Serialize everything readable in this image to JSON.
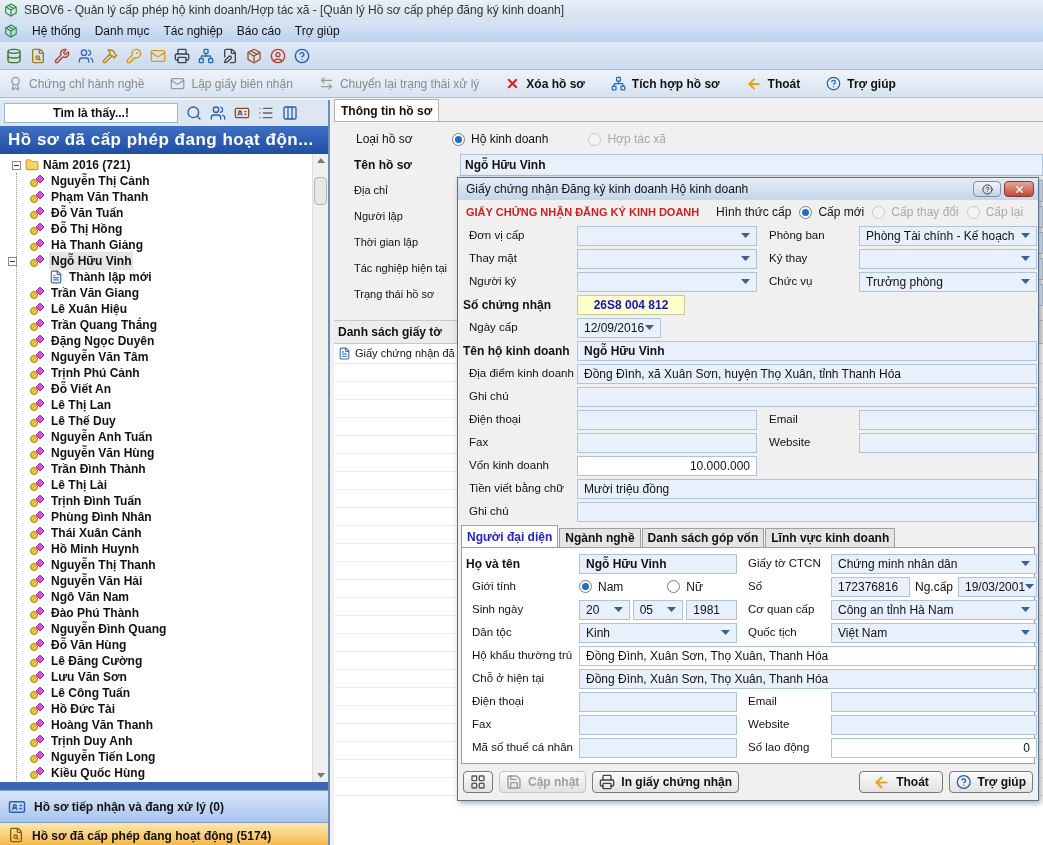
{
  "window": {
    "title": "SBOV6 - Quản lý cấp phép hộ kinh doanh/Hợp tác xã - [Quản lý Hồ sơ cấp phép đăng ký kinh doanh]"
  },
  "menu": [
    "Hệ thống",
    "Danh mục",
    "Tác nghiệp",
    "Báo cáo",
    "Trợ giúp"
  ],
  "commands": [
    {
      "label": "Chứng chỉ hành nghề",
      "kind": "certificate",
      "disabled": true
    },
    {
      "label": "Lập giấy biên nhận",
      "kind": "receipt",
      "disabled": true
    },
    {
      "label": "Chuyển lại trạng thái xử lý",
      "kind": "revert",
      "disabled": true
    },
    {
      "label": "Xóa hồ sơ",
      "kind": "delete",
      "disabled": false
    },
    {
      "label": "Tích hợp hồ sơ",
      "kind": "merge",
      "disabled": false
    },
    {
      "label": "Thoát",
      "kind": "exit",
      "disabled": false
    },
    {
      "label": "Trợ giúp",
      "kind": "help",
      "disabled": false
    }
  ],
  "sidebar": {
    "search": {
      "placeholder": "Tìm là thấy...!"
    },
    "title": "Hồ sơ đã cấp phép đang hoạt độn...",
    "tree": [
      {
        "label": "Năm 2016 (721)",
        "expanded": true,
        "children": [
          {
            "label": "Nguyễn Thị Cảnh",
            "selected": false
          },
          {
            "label": "Phạm Văn Thanh",
            "selected": false
          },
          {
            "label": "Đỗ Văn Tuấn",
            "selected": false
          },
          {
            "label": "Đỗ Thị Hồng",
            "selected": false
          },
          {
            "label": "Hà Thanh Giảng",
            "selected": false
          },
          {
            "label": "Ngỗ Hữu Vinh",
            "selected": true,
            "expanded": true,
            "children": [
              {
                "label": "Thành lập mới",
                "selected": false
              }
            ]
          },
          {
            "label": "Trần Văn Giang",
            "selected": false
          },
          {
            "label": "Lê Xuân Hiệu",
            "selected": false
          },
          {
            "label": "Trần Quang Thắng",
            "selected": false
          },
          {
            "label": "Đặng Ngọc Duyên",
            "selected": false
          },
          {
            "label": "Nguyễn Văn Tâm",
            "selected": false
          },
          {
            "label": "Trịnh Phú Cảnh",
            "selected": false
          },
          {
            "label": "Đỗ Viết An",
            "selected": false
          },
          {
            "label": "Lê Thị Lan",
            "selected": false
          },
          {
            "label": "Lê Thế Duy",
            "selected": false
          },
          {
            "label": "Nguyễn Anh Tuấn",
            "selected": false
          },
          {
            "label": "Nguyễn Văn Hùng",
            "selected": false
          },
          {
            "label": "Trần Đình Thành",
            "selected": false
          },
          {
            "label": "Lê Thị Lài",
            "selected": false
          },
          {
            "label": "Trịnh Đình Tuấn",
            "selected": false
          },
          {
            "label": "Phùng Đình Nhân",
            "selected": false
          },
          {
            "label": "Thái Xuân Cảnh",
            "selected": false
          },
          {
            "label": "Hồ Minh Huynh",
            "selected": false
          },
          {
            "label": "Nguyễn Thị Thanh",
            "selected": false
          },
          {
            "label": "Nguyễn Văn Hải",
            "selected": false
          },
          {
            "label": "Ngô Văn Nam",
            "selected": false
          },
          {
            "label": "Đào Phú Thành",
            "selected": false
          },
          {
            "label": "Nguyễn Đình Quang",
            "selected": false
          },
          {
            "label": "Đỗ Văn Hùng",
            "selected": false
          },
          {
            "label": "Lê Đăng Cường",
            "selected": false
          },
          {
            "label": "Lưu Văn Sơn",
            "selected": false
          },
          {
            "label": "Lê Công Tuấn",
            "selected": false
          },
          {
            "label": "Hồ Đức Tài",
            "selected": false
          },
          {
            "label": "Hoàng Văn Thanh",
            "selected": false
          },
          {
            "label": "Trịnh Duy Anh",
            "selected": false
          },
          {
            "label": "Nguyễn Tiến Long",
            "selected": false
          },
          {
            "label": "Kiều Quốc Hùng",
            "selected": false
          }
        ]
      }
    ],
    "sections": [
      {
        "label": "Hồ sơ tiếp nhận và đang xử lý (0)",
        "selected": false
      },
      {
        "label": "Hồ sơ đã cấp phép đang hoạt động (5174)",
        "selected": true
      }
    ]
  },
  "main": {
    "tabs": [
      {
        "label": "Thông tin hồ sơ",
        "selected": true
      }
    ],
    "record_type": {
      "label": "Loại hồ sơ",
      "options": [
        {
          "label": "Hộ kinh doanh",
          "selected": true,
          "disabled": false
        },
        {
          "label": "Hợp tác xã",
          "selected": false,
          "disabled": true
        }
      ]
    },
    "fields": [
      {
        "label": "Tên hồ sơ",
        "bold": true,
        "value": "Ngỗ Hữu Vinh"
      },
      {
        "label": "Địa chỉ",
        "bold": false
      },
      {
        "label": "Người lập",
        "bold": false
      },
      {
        "label": "Thời gian  lập",
        "bold": false
      },
      {
        "label": "Tác nghiệp hiện tại",
        "bold": false
      },
      {
        "label": "Trạng thái hồ sơ",
        "bold": false
      }
    ],
    "documents": {
      "title": "Danh sách giấy tờ",
      "items": [
        "Giấy chứng nhận đă"
      ]
    }
  },
  "dialog": {
    "title": "Giấy chứng nhận Đăng ký kinh doanh Hộ kinh doanh",
    "heading": "GIẤY CHỨNG NHẬN ĐĂNG KÝ KINH DOANH",
    "issue_type": {
      "label": "Hình thức cấp",
      "options": [
        {
          "label": "Cấp mới",
          "selected": true,
          "disabled": false
        },
        {
          "label": "Cấp thay đổi",
          "selected": false,
          "disabled": true
        },
        {
          "label": "Cấp lại",
          "selected": false,
          "disabled": true
        }
      ]
    },
    "rows": [
      {
        "kind": "pair",
        "left": {
          "label": "Đơn vị cấp",
          "bold": false,
          "field": {
            "kind": "combo"
          }
        },
        "right": {
          "label": "Phòng ban",
          "bold": false,
          "field": {
            "kind": "combo",
            "value": "Phòng Tài chính - Kế hoạch"
          }
        }
      },
      {
        "kind": "pair",
        "left": {
          "label": "Thay mặt",
          "bold": false,
          "field": {
            "kind": "combo"
          }
        },
        "right": {
          "label": "Ký thay",
          "bold": false,
          "field": {
            "kind": "combo"
          }
        }
      },
      {
        "kind": "pair",
        "left": {
          "label": "Người ký",
          "bold": false,
          "field": {
            "kind": "combo"
          }
        },
        "right": {
          "label": "Chức vụ",
          "bold": false,
          "field": {
            "kind": "combo",
            "value": "Trưởng phòng"
          }
        }
      },
      {
        "kind": "single",
        "left": {
          "label": "Số chứng nhận",
          "bold": true,
          "field": {
            "kind": "highlight",
            "value": "26S8 004 812"
          }
        }
      },
      {
        "kind": "single",
        "left": {
          "label": "Ngày cấp",
          "bold": false,
          "field": {
            "kind": "date",
            "value": "12/09/2016"
          }
        }
      },
      {
        "kind": "full",
        "left": {
          "label": "Tên hộ kinh doanh",
          "bold": true,
          "field": {
            "kind": "name",
            "value": "Ngỗ Hữu Vinh"
          }
        }
      },
      {
        "kind": "full",
        "left": {
          "label": "Địa điểm kinh doanh",
          "bold": false,
          "field": {
            "kind": "text",
            "value": "Đồng Đình, xã Xuân Sơn, huyện Thọ Xuân, tỉnh Thanh Hóa"
          }
        }
      },
      {
        "kind": "full",
        "left": {
          "label": "Ghi chú",
          "bold": false,
          "field": {
            "kind": "text"
          }
        }
      },
      {
        "kind": "pair",
        "left": {
          "label": "Điện thoại",
          "bold": false,
          "field": {
            "kind": "text"
          }
        },
        "right": {
          "label": "Email",
          "bold": false,
          "field": {
            "kind": "text"
          }
        }
      },
      {
        "kind": "pair",
        "left": {
          "label": "Fax",
          "bold": false,
          "field": {
            "kind": "text"
          }
        },
        "right": {
          "label": "Website",
          "bold": false,
          "field": {
            "kind": "text"
          }
        }
      },
      {
        "kind": "single",
        "left": {
          "label": "Vốn kinh doanh",
          "bold": false,
          "field": {
            "kind": "number",
            "value": "10.000.000"
          }
        }
      },
      {
        "kind": "full",
        "left": {
          "label": "Tiền viết bằng chữ",
          "bold": false,
          "field": {
            "kind": "text",
            "value": "Mười triệu đồng"
          }
        }
      },
      {
        "kind": "full",
        "left": {
          "label": "Ghi chú",
          "bold": false,
          "field": {
            "kind": "text"
          }
        }
      }
    ],
    "tabs": [
      {
        "label": "Người đại diện",
        "selected": true
      },
      {
        "label": "Ngành nghề",
        "selected": false
      },
      {
        "label": "Danh sách góp vốn",
        "selected": false
      },
      {
        "label": "Lĩnh vực kinh doanh",
        "selected": false
      }
    ],
    "person_rows": [
      {
        "kind": "pair",
        "left": {
          "label": "Họ và tên",
          "bold": true,
          "field": {
            "kind": "name",
            "value": "Ngỗ Hữu Vinh"
          }
        },
        "right": {
          "label": "Giấy tờ CTCN",
          "bold": false,
          "field": {
            "kind": "combo",
            "value": "Chứng minh nhân dân"
          }
        }
      },
      {
        "kind": "pair",
        "left": {
          "label": "Giới tính",
          "bold": false,
          "field": {
            "kind": "radios",
            "options": [
              {
                "label": "Nam",
                "selected": true,
                "disabled": false
              },
              {
                "label": "Nữ",
                "selected": false,
                "disabled": false
              }
            ]
          }
        },
        "right": {
          "label": "Số",
          "bold": false,
          "field": {
            "kind": "group",
            "items": [
              {
                "kind": "text",
                "value": "172376816"
              },
              {
                "kind": "label",
                "value": "Ng.cấp"
              },
              {
                "kind": "combo",
                "value": "19/03/2001"
              }
            ]
          }
        }
      },
      {
        "kind": "pair",
        "left": {
          "label": "Sinh ngày",
          "bold": false,
          "field": {
            "kind": "group",
            "items": [
              {
                "kind": "combo",
                "value": "20"
              },
              {
                "kind": "combo",
                "value": "05"
              },
              {
                "kind": "text",
                "value": "1981"
              }
            ]
          }
        },
        "right": {
          "label": "Cơ quan cấp",
          "bold": false,
          "field": {
            "kind": "combo",
            "value": "Công an tỉnh Hà Nam"
          }
        }
      },
      {
        "kind": "pair",
        "left": {
          "label": "Dân tộc",
          "bold": false,
          "field": {
            "kind": "combo",
            "value": "Kinh"
          }
        },
        "right": {
          "label": "Quốc tịch",
          "bold": false,
          "field": {
            "kind": "combo",
            "value": "Việt Nam"
          }
        }
      },
      {
        "kind": "full",
        "left": {
          "label": "Hộ khẩu thường trú",
          "bold": false,
          "field": {
            "kind": "input",
            "value": "Đồng Đình, Xuân Sơn, Thọ Xuân, Thanh Hóa"
          }
        }
      },
      {
        "kind": "full",
        "left": {
          "label": "Chỗ ở hiện tại",
          "bold": false,
          "field": {
            "kind": "text",
            "value": "Đồng Đình, Xuân Sơn, Thọ Xuân, Thanh Hóa"
          }
        }
      },
      {
        "kind": "pair",
        "left": {
          "label": "Điện thoại",
          "bold": false,
          "field": {
            "kind": "text"
          }
        },
        "right": {
          "label": "Email",
          "bold": false,
          "field": {
            "kind": "text"
          }
        }
      },
      {
        "kind": "pair",
        "left": {
          "label": "Fax",
          "bold": false,
          "field": {
            "kind": "text"
          }
        },
        "right": {
          "label": "Website",
          "bold": false,
          "field": {
            "kind": "text"
          }
        }
      },
      {
        "kind": "pair",
        "left": {
          "label": "Mã số thuế cá nhân",
          "bold": false,
          "field": {
            "kind": "text"
          }
        },
        "right": {
          "label": "Số lao động",
          "bold": false,
          "field": {
            "kind": "number",
            "value": "0"
          }
        }
      }
    ],
    "buttons": [
      {
        "kind": "layout",
        "disabled": false
      },
      {
        "kind": "save",
        "label": "Cập nhật",
        "disabled": true
      },
      {
        "kind": "print",
        "label": "In giấy chứng nhận",
        "disabled": false
      },
      {
        "kind": "exit",
        "label": "Thoát",
        "disabled": false
      },
      {
        "kind": "help",
        "label": "Trợ giúp",
        "disabled": false
      }
    ]
  }
}
